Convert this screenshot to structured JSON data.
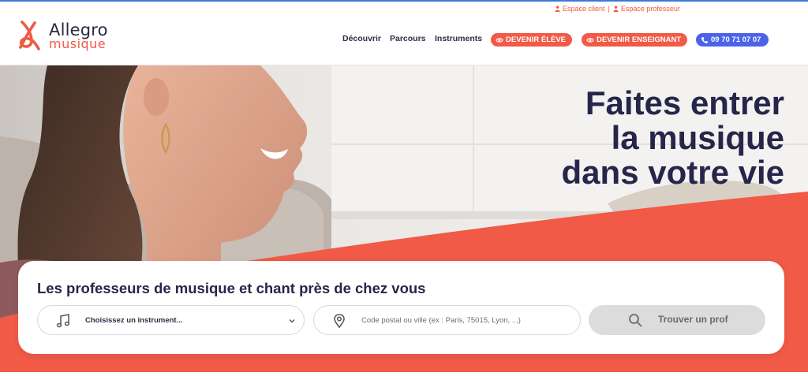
{
  "colors": {
    "accent": "#f05a46",
    "navy": "#26264a",
    "phone_pill": "#4b63ea"
  },
  "util_links": {
    "client": "Espace client",
    "separator": "|",
    "teacher": "Espace professeur"
  },
  "logo": {
    "line1": "Allegro",
    "line2": "musique"
  },
  "nav": {
    "discover": "Découvrir",
    "paths": "Parcours",
    "instruments": "Instruments"
  },
  "pills": {
    "student": "DEVENIR ÉLÈVE",
    "teacher": "DEVENIR ENSEIGNANT",
    "phone": "09 70 71 07 07"
  },
  "hero": {
    "line1": "Faites entrer",
    "line2": "la musique",
    "line3": "dans votre vie"
  },
  "search": {
    "title": "Les professeurs de musique et chant près de chez vous",
    "instrument_value": "Choisissez un instrument...",
    "location_placeholder": "Code postal ou ville (ex : Paris, 75015, Lyon, ...)",
    "button_label": "Trouver un prof"
  },
  "icons": {
    "person": "person-icon",
    "eye": "eye-icon",
    "phone": "phone-icon",
    "note": "music-note-icon",
    "pin": "location-pin-icon",
    "search": "search-icon",
    "chevron": "chevron-down-icon"
  }
}
